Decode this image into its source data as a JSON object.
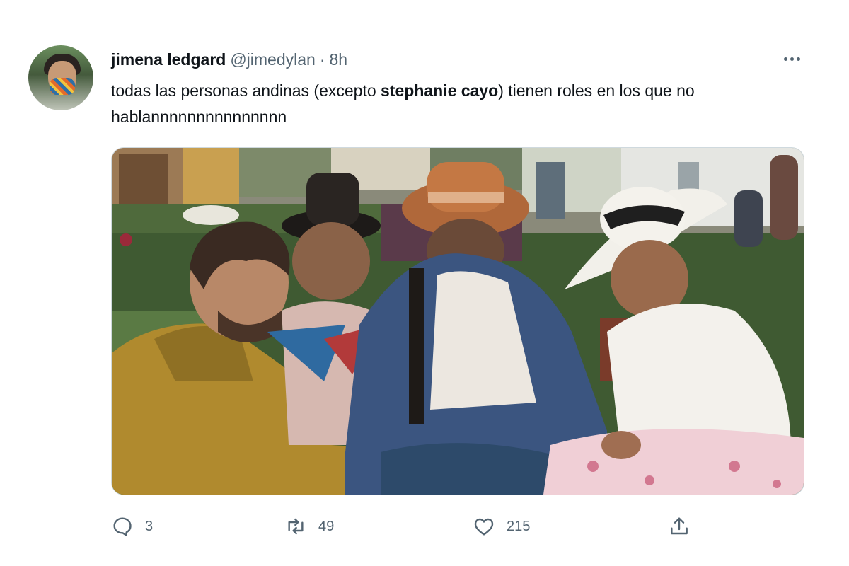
{
  "tweet": {
    "author_name": "jimena ledgard",
    "author_handle": "@jimedylan",
    "separator": "·",
    "time": "8h",
    "text_part1": "todas las personas andinas (excepto ",
    "text_bold": "stephanie cayo",
    "text_part2": ") tienen roles en los que no hablannnnnnnnnnnnnnn"
  },
  "actions": {
    "reply_count": "3",
    "retweet_count": "49",
    "like_count": "215"
  },
  "icons": {
    "reply": "reply-icon",
    "retweet": "retweet-icon",
    "like": "heart-icon",
    "share": "share-icon",
    "more": "more-icon"
  },
  "colors": {
    "text_primary": "#0f1419",
    "text_secondary": "#536471",
    "border": "#cfd9de"
  }
}
